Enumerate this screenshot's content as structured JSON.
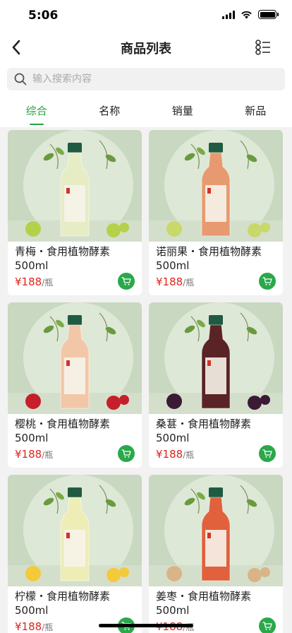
{
  "status_bar": {
    "time": "5:06"
  },
  "nav": {
    "title": "商品列表",
    "back_icon": "chevron-left-icon",
    "list_icon": "list-view-icon"
  },
  "search": {
    "placeholder": "输入搜索内容",
    "value": ""
  },
  "tabs": [
    {
      "label": "综合",
      "active": true
    },
    {
      "label": "名称",
      "active": false
    },
    {
      "label": "销量",
      "active": false
    },
    {
      "label": "新品",
      "active": false
    }
  ],
  "products": [
    {
      "name": "青梅・食用植物酵素",
      "spec": "500ml",
      "price": "¥188",
      "unit": "/瓶",
      "liquid": "#e6ecc4",
      "fruit": "#b5d14a"
    },
    {
      "name": "诺丽果・食用植物酵素",
      "spec": "500ml",
      "price": "¥188",
      "unit": "/瓶",
      "liquid": "#e79a6f",
      "fruit": "#c9d86a"
    },
    {
      "name": "樱桃・食用植物酵素",
      "spec": "500ml",
      "price": "¥188",
      "unit": "/瓶",
      "liquid": "#f2c7a8",
      "fruit": "#c51f2b"
    },
    {
      "name": "桑葚・食用植物酵素",
      "spec": "500ml",
      "price": "¥188",
      "unit": "/瓶",
      "liquid": "#5a2326",
      "fruit": "#3a1a35"
    },
    {
      "name": "柠檬・食用植物酵素",
      "spec": "500ml",
      "price": "¥188",
      "unit": "/瓶",
      "liquid": "#eeedb6",
      "fruit": "#f4c93a"
    },
    {
      "name": "姜枣・食用植物酵素",
      "spec": "500ml",
      "price": "¥188",
      "unit": "/瓶",
      "liquid": "#e0613c",
      "fruit": "#d9b487"
    }
  ],
  "colors": {
    "accent": "#23a23d",
    "price": "#e0231b",
    "cart": "#2aa84a",
    "bottle_cap": "#1f5b42",
    "bg": "#c9d8c0"
  }
}
